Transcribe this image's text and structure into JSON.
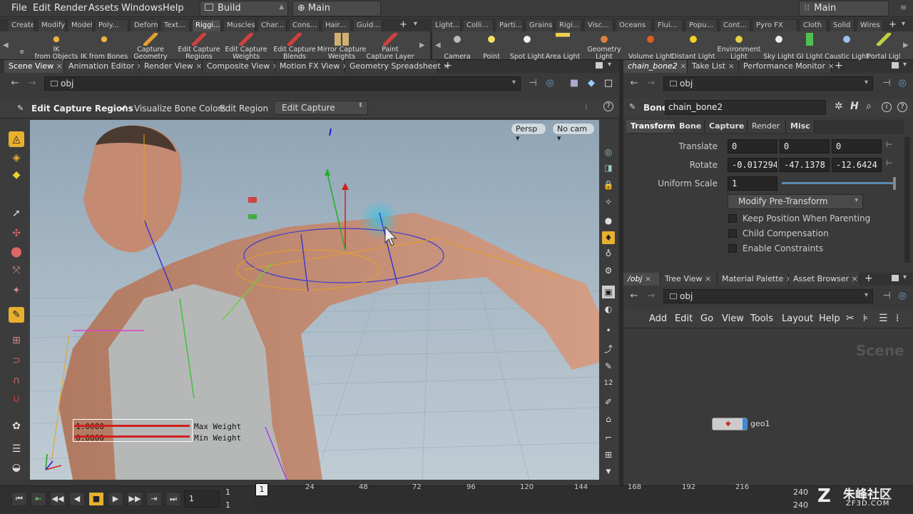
{
  "menu": [
    "File",
    "Edit",
    "Render",
    "Assets",
    "Windows",
    "Help"
  ],
  "desktop": {
    "build": "Build",
    "main": "Main",
    "right": "Main"
  },
  "shelf_tabs_left": [
    "Create",
    "Modify",
    "Model",
    "Poly...",
    "Deform",
    "Text...",
    "Riggi...",
    "Muscles",
    "Char...",
    "Cons...",
    "Hair...",
    "Guid..."
  ],
  "shelf_tabs_right": [
    "Light...",
    "Colli...",
    "Parti...",
    "Grains",
    "Rigi...",
    "Visc...",
    "Oceans",
    "Flui...",
    "Popu...",
    "Cont...",
    "Pyro FX",
    "Cloth",
    "Solid",
    "Wires"
  ],
  "shelf_tools_left": [
    {
      "l1": "IK",
      "l2": "from Objects"
    },
    {
      "l1": "",
      "l2": "IK from Bones"
    },
    {
      "l1": "Capture",
      "l2": "Geometry"
    },
    {
      "l1": "Edit Capture",
      "l2": "Regions"
    },
    {
      "l1": "Edit Capture",
      "l2": "Weights"
    },
    {
      "l1": "Edit Capture",
      "l2": "Blends"
    },
    {
      "l1": "Mirror Capture",
      "l2": "Weights"
    },
    {
      "l1": "Paint",
      "l2": "Capture Layer"
    }
  ],
  "shelf_tools_right": [
    {
      "l1": "",
      "l2": "Camera"
    },
    {
      "l1": "",
      "l2": "Point Light"
    },
    {
      "l1": "",
      "l2": "Spot Light"
    },
    {
      "l1": "",
      "l2": "Area Light"
    },
    {
      "l1": "Geometry",
      "l2": "Light"
    },
    {
      "l1": "",
      "l2": "Volume Light"
    },
    {
      "l1": "",
      "l2": "Distant Light"
    },
    {
      "l1": "Environment",
      "l2": "Light"
    },
    {
      "l1": "",
      "l2": "Sky Light"
    },
    {
      "l1": "",
      "l2": "GI Light"
    },
    {
      "l1": "",
      "l2": "Caustic Light"
    },
    {
      "l1": "",
      "l2": "Portal Ligl"
    }
  ],
  "left_tabs": [
    "Scene View",
    "Animation Editor",
    "Render View",
    "Composite View",
    "Motion FX View",
    "Geometry Spreadsheet"
  ],
  "left_path": "obj",
  "tool_options": {
    "title": "Edit Capture Regions",
    "visualize": "Visualize Bone Colors",
    "edit_region": "Edit Region",
    "mode": "Edit Capture"
  },
  "viewport": {
    "persp": "Persp",
    "cam": "No cam",
    "max_val": "1.0000",
    "min_val": "0.0000",
    "max_label": "Max Weight",
    "min_label": "Min Weight"
  },
  "right_tabs": [
    "chain_bone2",
    "Take List",
    "Performance Monitor"
  ],
  "right_path": "obj",
  "node": {
    "type": "Bone",
    "name": "chain_bone2"
  },
  "parm_tabs": [
    "Transform",
    "Bone",
    "Capture",
    "Render",
    "Misc"
  ],
  "parms": {
    "translate_label": "Translate",
    "t": [
      "0",
      "0",
      "0"
    ],
    "rotate_label": "Rotate",
    "r": [
      "-0.017294",
      "-47.1378",
      "-12.6424"
    ],
    "scale_label": "Uniform Scale",
    "s": "1",
    "pre_transform": "Modify Pre-Transform",
    "keep_pos": "Keep Position When Parenting",
    "child_comp": "Child Compensation",
    "constraints": "Enable Constraints"
  },
  "net_tabs": [
    "/obj",
    "Tree View",
    "Material Palette",
    "Asset Browser"
  ],
  "net_path": "obj",
  "net_menu": [
    "Add",
    "Edit",
    "Go",
    "View",
    "Tools",
    "Layout",
    "Help"
  ],
  "network": {
    "watermark": "Scene",
    "node": "geo1"
  },
  "timeline": {
    "frame": "1",
    "start": "1",
    "start2": "1",
    "end": "240",
    "end2": "240",
    "current": "1",
    "ticks": [
      "24",
      "48",
      "72",
      "96",
      "120",
      "144",
      "168",
      "192",
      "216"
    ]
  },
  "watermark": {
    "cn": "朱峰社区",
    "url": "ZF3D.COM"
  },
  "colors": {
    "accent": "#e8b02e",
    "bg": "#3a3a3a",
    "viewport_top": "#8fa4b5"
  }
}
